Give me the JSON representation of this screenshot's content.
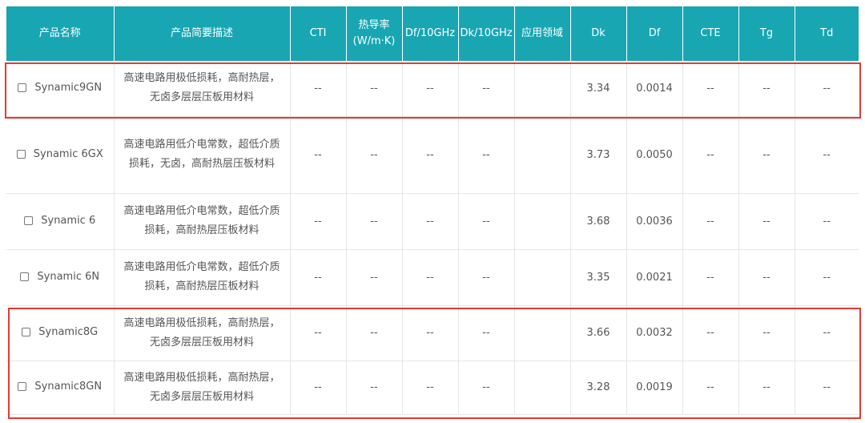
{
  "table": {
    "headers": [
      "产品名称",
      "产品简要描述",
      "CTI",
      "热导率\n(W/m·K)",
      "Df/10GHz",
      "Dk/10GHz",
      "应用领域",
      "Dk",
      "Df",
      "CTE",
      "Tg",
      "Td"
    ],
    "rows": [
      {
        "name": "Synamic9GN",
        "desc": "高速电路用极低损耗，高耐热层，无卤多层层压板用材料",
        "cti": "--",
        "thermal": "--",
        "df10": "--",
        "dk10": "--",
        "app": "",
        "dk": "3.34",
        "df": "0.0014",
        "cte": "--",
        "tg": "--",
        "td": "--"
      },
      {
        "name": "Synamic 6GX",
        "desc": "高速电路用低介电常数，超低介质损耗，无卤，高耐热层压板材料",
        "cti": "--",
        "thermal": "--",
        "df10": "--",
        "dk10": "--",
        "app": "",
        "dk": "3.73",
        "df": "0.0050",
        "cte": "--",
        "tg": "--",
        "td": "--"
      },
      {
        "name": "Synamic 6",
        "desc": "高速电路用低介电常数，超低介质损耗，高耐热层压板材料",
        "cti": "--",
        "thermal": "--",
        "df10": "--",
        "dk10": "--",
        "app": "",
        "dk": "3.68",
        "df": "0.0036",
        "cte": "--",
        "tg": "--",
        "td": "--"
      },
      {
        "name": "Synamic 6N",
        "desc": "高速电路用低介电常数，超低介质损耗，高耐热层压板材料",
        "cti": "--",
        "thermal": "--",
        "df10": "--",
        "dk10": "--",
        "app": "",
        "dk": "3.35",
        "df": "0.0021",
        "cte": "--",
        "tg": "--",
        "td": "--"
      },
      {
        "name": "Synamic8G",
        "desc": "高速电路用极低损耗，高耐热层，无卤多层层压板用材料",
        "cti": "--",
        "thermal": "--",
        "df10": "--",
        "dk10": "--",
        "app": "",
        "dk": "3.66",
        "df": "0.0032",
        "cte": "--",
        "tg": "--",
        "td": "--"
      },
      {
        "name": "Synamic8GN",
        "desc": "高速电路用极低损耗，高耐热层，无卤多层层压板用材料",
        "cti": "--",
        "thermal": "--",
        "df10": "--",
        "dk10": "--",
        "app": "",
        "dk": "3.28",
        "df": "0.0019",
        "cte": "--",
        "tg": "--",
        "td": "--"
      }
    ]
  },
  "colors": {
    "header_bg": "#18a6b3",
    "highlight": "#e53935",
    "border": "#e6e6e6"
  }
}
